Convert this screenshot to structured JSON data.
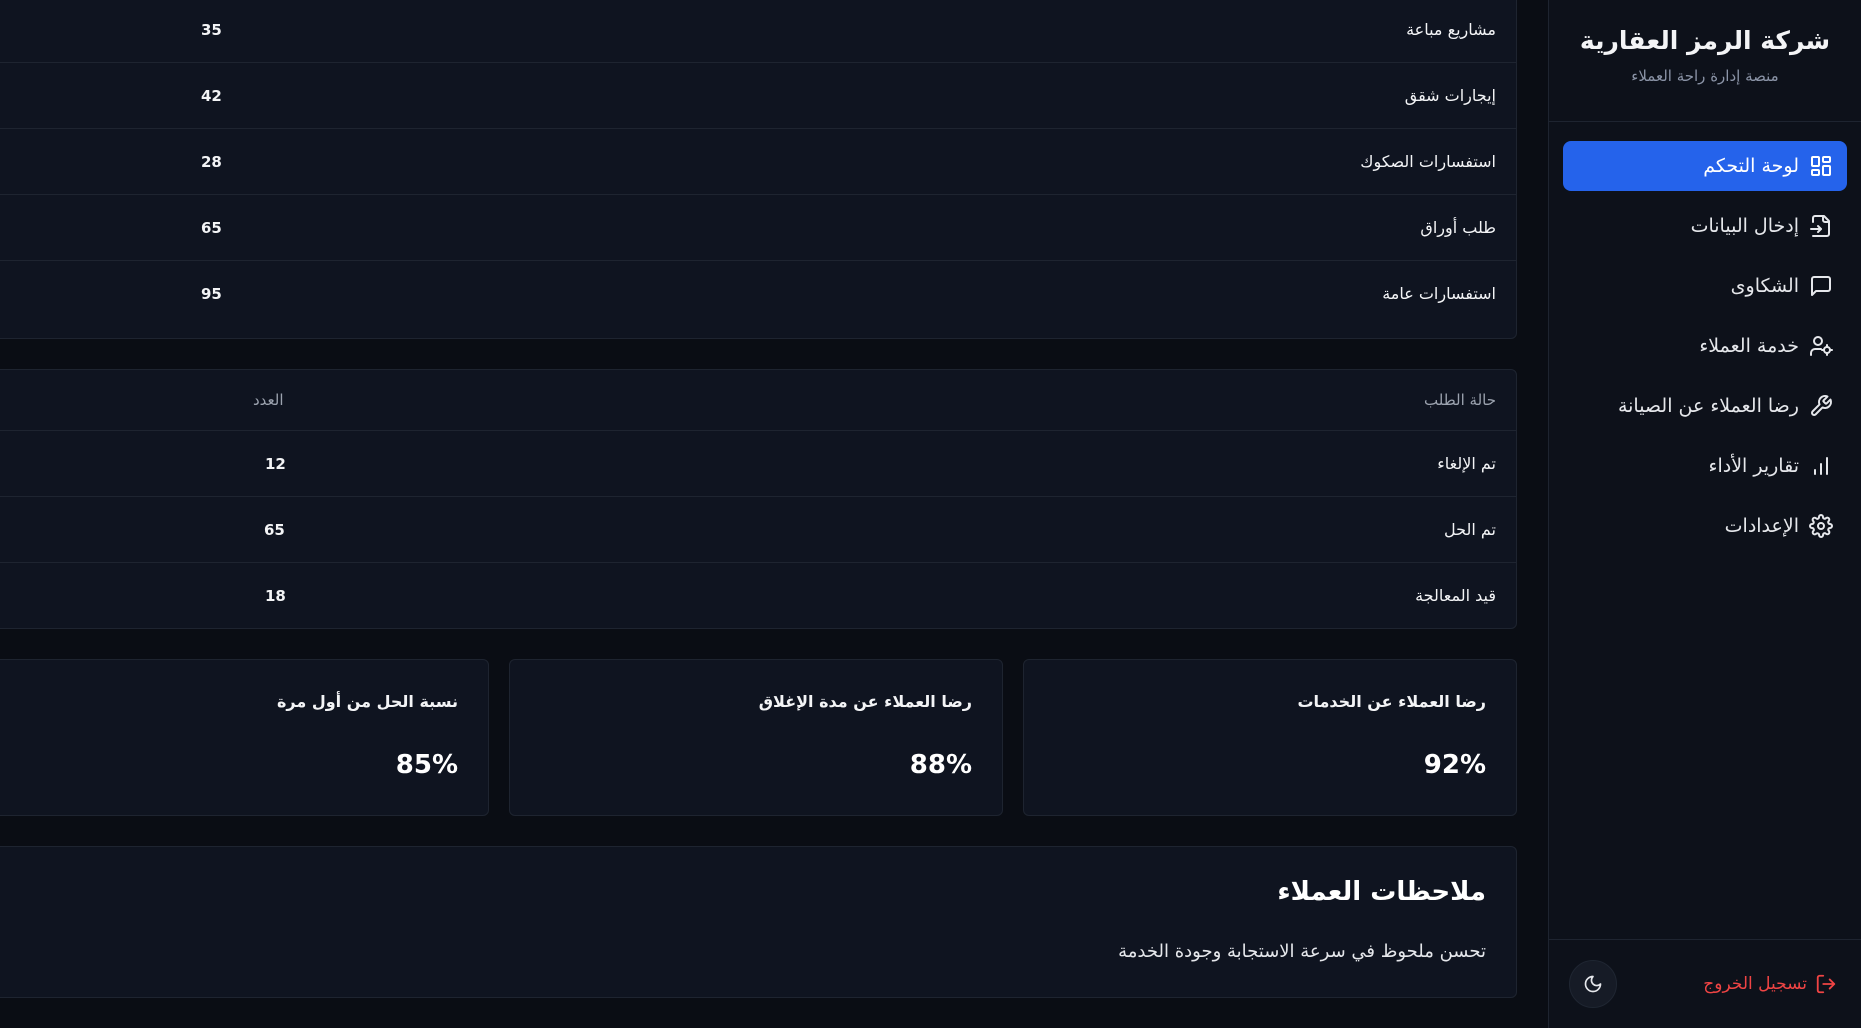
{
  "sidebar": {
    "brand_title": "شركة الرمز العقارية",
    "brand_subtitle": "منصة إدارة راحة العملاء",
    "items": [
      {
        "label": "لوحة التحكم",
        "icon": "dashboard-icon",
        "active": true
      },
      {
        "label": "إدخال البيانات",
        "icon": "file-input-icon",
        "active": false
      },
      {
        "label": "الشكاوى",
        "icon": "message-icon",
        "active": false
      },
      {
        "label": "خدمة العملاء",
        "icon": "user-cog-icon",
        "active": false
      },
      {
        "label": "رضا العملاء عن الصيانة",
        "icon": "wrench-icon",
        "active": false
      },
      {
        "label": "تقارير الأداء",
        "icon": "bar-chart-icon",
        "active": false
      },
      {
        "label": "الإعدادات",
        "icon": "gear-icon",
        "active": false
      }
    ],
    "logout_label": "تسجيل الخروج",
    "theme_icon": "moon-icon"
  },
  "categories_table": {
    "rows": [
      {
        "label": "مشاريع مباعة",
        "value": "35"
      },
      {
        "label": "إيجارات شقق",
        "value": "42"
      },
      {
        "label": "استفسارات الصكوك",
        "value": "28"
      },
      {
        "label": "طلب أوراق",
        "value": "65"
      },
      {
        "label": "استفسارات عامة",
        "value": "95"
      }
    ]
  },
  "status_table": {
    "headers": {
      "status": "حالة الطلب",
      "count": "العدد"
    },
    "rows": [
      {
        "label": "تم الإلغاء",
        "value": "12"
      },
      {
        "label": "تم الحل",
        "value": "65"
      },
      {
        "label": "قيد المعالجة",
        "value": "18"
      }
    ]
  },
  "stats": [
    {
      "title": "رضا العملاء عن الخدمات",
      "value": "92%"
    },
    {
      "title": "رضا العملاء عن مدة الإغلاق",
      "value": "88%"
    },
    {
      "title": "نسبة الحل من أول مرة",
      "value": "85%"
    }
  ],
  "notes": {
    "title": "ملاحظات العملاء",
    "text": "تحسن ملحوظ في سرعة الاستجابة وجودة الخدمة"
  },
  "colors": {
    "accent": "#2563eb",
    "background": "#0a0d14",
    "card": "#0f1420",
    "danger": "#ef4444"
  }
}
